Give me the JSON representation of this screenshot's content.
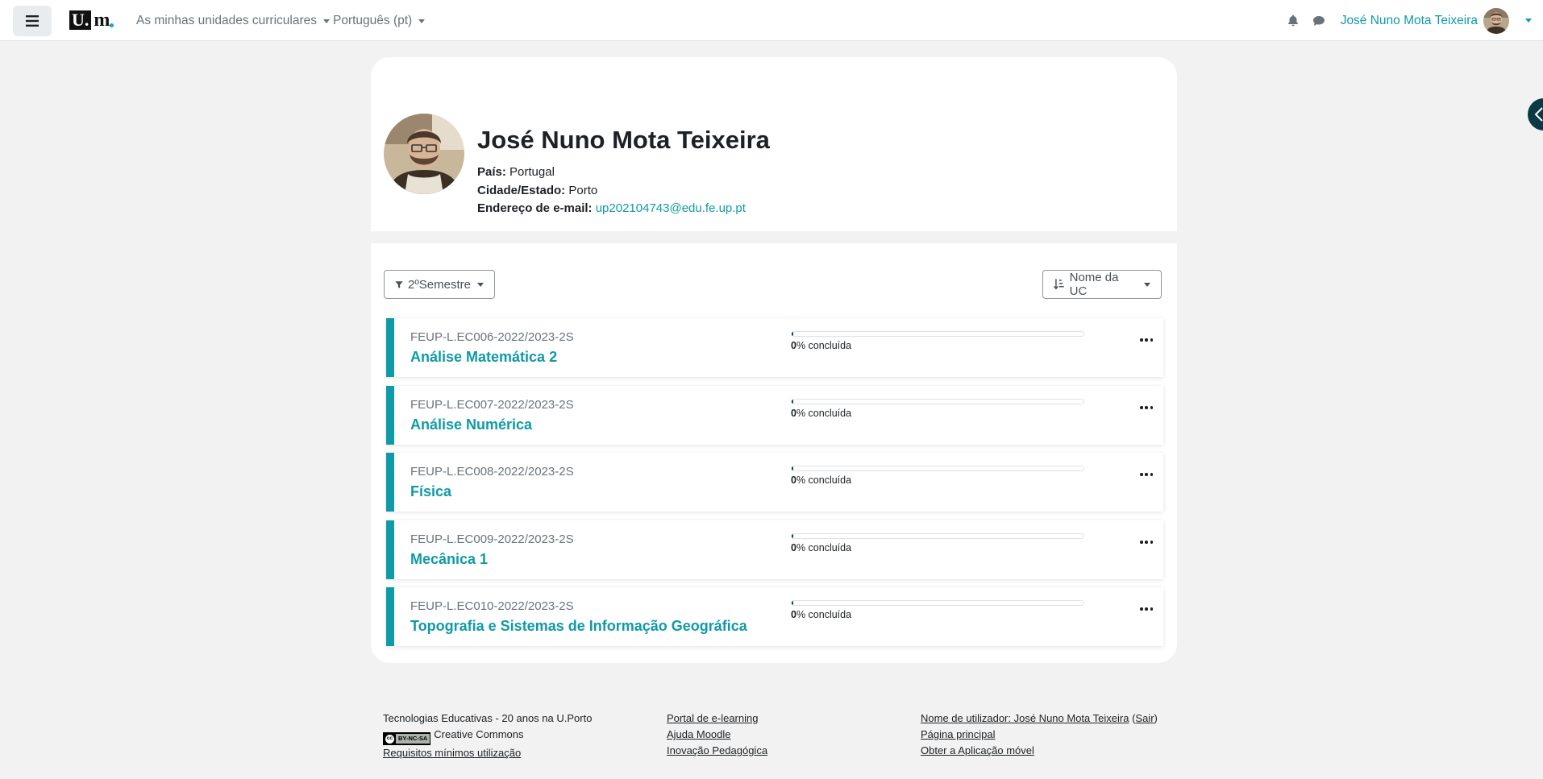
{
  "navbar": {
    "logo_text": "U.",
    "logo_text2": "m",
    "menu_courses": "As minhas unidades curriculares",
    "menu_language": "Português (pt)",
    "user_name": "José Nuno Mota Teixeira",
    "icons": [
      "hamburger-icon",
      "bell-icon",
      "chat-icon"
    ]
  },
  "profile": {
    "name": "José Nuno Mota Teixeira",
    "country_label": "País:",
    "country": "Portugal",
    "city_label": "Cidade/Estado:",
    "city": "Porto",
    "email_label": "Endereço de e-mail:",
    "email": "up202104743@edu.fe.up.pt"
  },
  "courses": {
    "filter_label": "2ºSemestre",
    "sort_label": "Nome da UC",
    "items": [
      {
        "code": "FEUP-L.EC006-2022/2023-2S",
        "title": "Análise Matemática 2",
        "progress": 0,
        "progress_percent": "0",
        "progress_suffix": "% concluída"
      },
      {
        "code": "FEUP-L.EC007-2022/2023-2S",
        "title": "Análise Numérica",
        "progress": 0,
        "progress_percent": "0",
        "progress_suffix": "% concluída"
      },
      {
        "code": "FEUP-L.EC008-2022/2023-2S",
        "title": "Física",
        "progress": 0,
        "progress_percent": "0",
        "progress_suffix": "% concluída"
      },
      {
        "code": "FEUP-L.EC009-2022/2023-2S",
        "title": "Mecânica 1",
        "progress": 0,
        "progress_percent": "0",
        "progress_suffix": "% concluída"
      },
      {
        "code": "FEUP-L.EC010-2022/2023-2S",
        "title": "Topografia e Sistemas de Informação Geográfica",
        "progress": 0,
        "progress_percent": "0",
        "progress_suffix": "% concluída"
      }
    ]
  },
  "footer": {
    "col1": {
      "tagline": "Tecnologias Educativas - 20 anos na U.Porto",
      "cc_badge": "BY-NC-SA",
      "cc_text": "Creative Commons",
      "requirements": "Requisitos mínimos utilização"
    },
    "col2": {
      "portal": "Portal de e-learning",
      "help": "Ajuda Moodle",
      "innovation": "Inovação Pedagógica"
    },
    "col3": {
      "username_prefix": "Nome de utilizador: José Nuno Mota Teixeira",
      "logout_open": " (",
      "logout": "Sair",
      "logout_close": ")",
      "home": "Página principal",
      "app": "Obter a Aplicação móvel"
    }
  },
  "colors": {
    "accent": "#0f9aa8",
    "dark": "#0b3a44",
    "background": "#f2f2f2"
  }
}
